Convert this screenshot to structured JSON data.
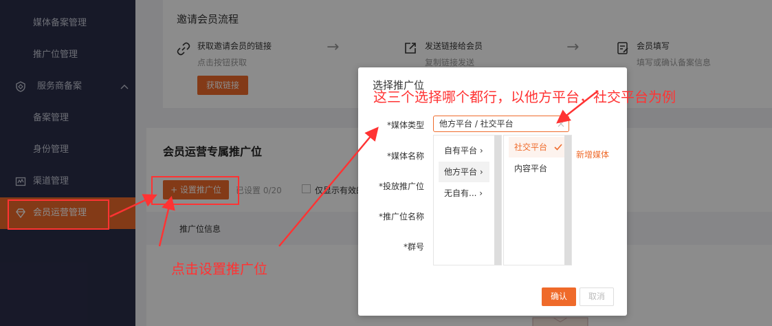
{
  "sidebar": {
    "items": [
      {
        "label": "媒体备案管理",
        "icon": ""
      },
      {
        "label": "推广位管理",
        "icon": ""
      },
      {
        "label": "服务商备案",
        "icon": "shield-icon"
      },
      {
        "label": "备案管理",
        "icon": ""
      },
      {
        "label": "身份管理",
        "icon": ""
      },
      {
        "label": "渠道管理",
        "icon": "channel-icon"
      },
      {
        "label": "会员运营管理",
        "icon": "diamond-icon"
      }
    ],
    "active_color": "#ef6a2a"
  },
  "invite": {
    "title": "邀请会员流程",
    "steps": [
      {
        "title": "获取邀请会员的链接",
        "sub": "点击按钮获取",
        "icon": "link-icon"
      },
      {
        "title": "发送链接给会员",
        "sub": "复制链接发送",
        "icon": "share-icon"
      },
      {
        "title": "会员填写",
        "sub": "填写或确认备案信息",
        "icon": "form-icon"
      }
    ],
    "get_link_button": "获取链接"
  },
  "section": {
    "title": "会员运营专属推广位",
    "set_button": "+ 设置推广位",
    "set_count_label": "已设置",
    "set_count": "0/20",
    "only_valid_label": "仅显示有效的",
    "table_header": "推广位信息"
  },
  "modal": {
    "title": "选择推广位",
    "fields": [
      {
        "label": "*媒体类型"
      },
      {
        "label": "*媒体名称"
      },
      {
        "label": "*投放推广位"
      },
      {
        "label": "*推广位名称"
      },
      {
        "label": "*群号"
      }
    ],
    "cascader_value": "他方平台 / 社交平台",
    "level1": [
      "自有平台",
      "他方平台",
      "无自有..."
    ],
    "level2": [
      "社交平台",
      "内容平台"
    ],
    "add_media_link": "新增媒体",
    "confirm": "确认",
    "cancel": "取消"
  },
  "annotations": {
    "top_note": "这三个选择哪个都行，以他方平台，社交平台为例",
    "bottom_note": "点击设置推广位"
  }
}
